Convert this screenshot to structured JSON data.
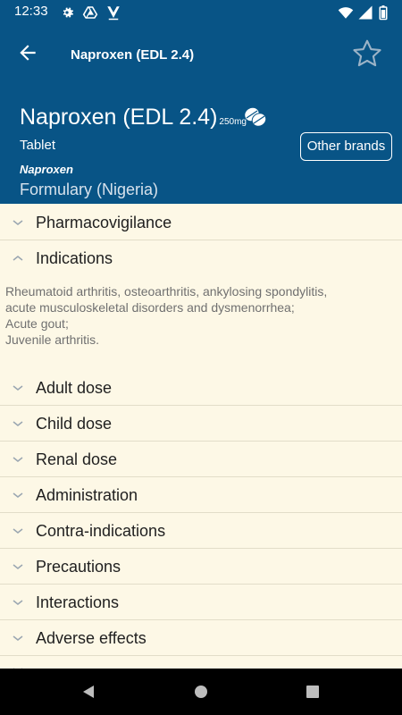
{
  "status_bar": {
    "time": "12:33",
    "left_icons": [
      "settings-icon",
      "drive-icon",
      "download-icon"
    ],
    "right_icons": [
      "wifi-icon",
      "signal-icon",
      "battery-icon"
    ]
  },
  "app_bar": {
    "title": "Naproxen (EDL 2.4)"
  },
  "drug": {
    "name": "Naproxen (EDL 2.4)",
    "strength": "250mg",
    "form": "Tablet",
    "generic_name": "Naproxen",
    "formulary": "Formulary (Nigeria)",
    "other_brands_label": "Other brands"
  },
  "sections": {
    "pharmacovigilance": "Pharmacovigilance",
    "indications": "Indications",
    "indications_text": [
      "Rheumatoid arthritis, osteoarthritis, ankylosing spondylitis,",
      "acute musculoskeletal disorders and dysmenorrhea;",
      "Acute gout;",
      "Juvenile arthritis."
    ],
    "collapsed": [
      "Adult dose",
      "Child dose",
      "Renal dose",
      "Administration",
      "Contra-indications",
      "Precautions",
      "Interactions",
      "Adverse effects"
    ]
  },
  "colors": {
    "header_blue": "#085486",
    "background": "#fdf8e6",
    "chevron": "#9aa6b1"
  }
}
